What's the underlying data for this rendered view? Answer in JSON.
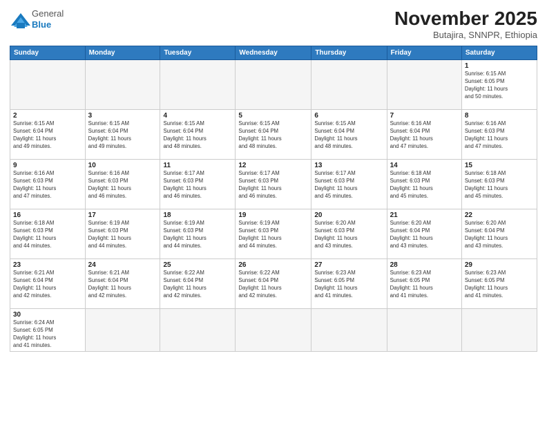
{
  "header": {
    "logo_general": "General",
    "logo_blue": "Blue",
    "month": "November 2025",
    "location": "Butajira, SNNPR, Ethiopia"
  },
  "weekdays": [
    "Sunday",
    "Monday",
    "Tuesday",
    "Wednesday",
    "Thursday",
    "Friday",
    "Saturday"
  ],
  "weeks": [
    [
      {
        "num": "",
        "info": ""
      },
      {
        "num": "",
        "info": ""
      },
      {
        "num": "",
        "info": ""
      },
      {
        "num": "",
        "info": ""
      },
      {
        "num": "",
        "info": ""
      },
      {
        "num": "",
        "info": ""
      },
      {
        "num": "1",
        "info": "Sunrise: 6:15 AM\nSunset: 6:05 PM\nDaylight: 11 hours\nand 50 minutes."
      }
    ],
    [
      {
        "num": "2",
        "info": "Sunrise: 6:15 AM\nSunset: 6:04 PM\nDaylight: 11 hours\nand 49 minutes."
      },
      {
        "num": "3",
        "info": "Sunrise: 6:15 AM\nSunset: 6:04 PM\nDaylight: 11 hours\nand 49 minutes."
      },
      {
        "num": "4",
        "info": "Sunrise: 6:15 AM\nSunset: 6:04 PM\nDaylight: 11 hours\nand 48 minutes."
      },
      {
        "num": "5",
        "info": "Sunrise: 6:15 AM\nSunset: 6:04 PM\nDaylight: 11 hours\nand 48 minutes."
      },
      {
        "num": "6",
        "info": "Sunrise: 6:15 AM\nSunset: 6:04 PM\nDaylight: 11 hours\nand 48 minutes."
      },
      {
        "num": "7",
        "info": "Sunrise: 6:16 AM\nSunset: 6:04 PM\nDaylight: 11 hours\nand 47 minutes."
      },
      {
        "num": "8",
        "info": "Sunrise: 6:16 AM\nSunset: 6:03 PM\nDaylight: 11 hours\nand 47 minutes."
      }
    ],
    [
      {
        "num": "9",
        "info": "Sunrise: 6:16 AM\nSunset: 6:03 PM\nDaylight: 11 hours\nand 47 minutes."
      },
      {
        "num": "10",
        "info": "Sunrise: 6:16 AM\nSunset: 6:03 PM\nDaylight: 11 hours\nand 46 minutes."
      },
      {
        "num": "11",
        "info": "Sunrise: 6:17 AM\nSunset: 6:03 PM\nDaylight: 11 hours\nand 46 minutes."
      },
      {
        "num": "12",
        "info": "Sunrise: 6:17 AM\nSunset: 6:03 PM\nDaylight: 11 hours\nand 46 minutes."
      },
      {
        "num": "13",
        "info": "Sunrise: 6:17 AM\nSunset: 6:03 PM\nDaylight: 11 hours\nand 45 minutes."
      },
      {
        "num": "14",
        "info": "Sunrise: 6:18 AM\nSunset: 6:03 PM\nDaylight: 11 hours\nand 45 minutes."
      },
      {
        "num": "15",
        "info": "Sunrise: 6:18 AM\nSunset: 6:03 PM\nDaylight: 11 hours\nand 45 minutes."
      }
    ],
    [
      {
        "num": "16",
        "info": "Sunrise: 6:18 AM\nSunset: 6:03 PM\nDaylight: 11 hours\nand 44 minutes."
      },
      {
        "num": "17",
        "info": "Sunrise: 6:19 AM\nSunset: 6:03 PM\nDaylight: 11 hours\nand 44 minutes."
      },
      {
        "num": "18",
        "info": "Sunrise: 6:19 AM\nSunset: 6:03 PM\nDaylight: 11 hours\nand 44 minutes."
      },
      {
        "num": "19",
        "info": "Sunrise: 6:19 AM\nSunset: 6:03 PM\nDaylight: 11 hours\nand 44 minutes."
      },
      {
        "num": "20",
        "info": "Sunrise: 6:20 AM\nSunset: 6:03 PM\nDaylight: 11 hours\nand 43 minutes."
      },
      {
        "num": "21",
        "info": "Sunrise: 6:20 AM\nSunset: 6:04 PM\nDaylight: 11 hours\nand 43 minutes."
      },
      {
        "num": "22",
        "info": "Sunrise: 6:20 AM\nSunset: 6:04 PM\nDaylight: 11 hours\nand 43 minutes."
      }
    ],
    [
      {
        "num": "23",
        "info": "Sunrise: 6:21 AM\nSunset: 6:04 PM\nDaylight: 11 hours\nand 42 minutes."
      },
      {
        "num": "24",
        "info": "Sunrise: 6:21 AM\nSunset: 6:04 PM\nDaylight: 11 hours\nand 42 minutes."
      },
      {
        "num": "25",
        "info": "Sunrise: 6:22 AM\nSunset: 6:04 PM\nDaylight: 11 hours\nand 42 minutes."
      },
      {
        "num": "26",
        "info": "Sunrise: 6:22 AM\nSunset: 6:04 PM\nDaylight: 11 hours\nand 42 minutes."
      },
      {
        "num": "27",
        "info": "Sunrise: 6:23 AM\nSunset: 6:05 PM\nDaylight: 11 hours\nand 41 minutes."
      },
      {
        "num": "28",
        "info": "Sunrise: 6:23 AM\nSunset: 6:05 PM\nDaylight: 11 hours\nand 41 minutes."
      },
      {
        "num": "29",
        "info": "Sunrise: 6:23 AM\nSunset: 6:05 PM\nDaylight: 11 hours\nand 41 minutes."
      }
    ],
    [
      {
        "num": "30",
        "info": "Sunrise: 6:24 AM\nSunset: 6:05 PM\nDaylight: 11 hours\nand 41 minutes."
      },
      {
        "num": "",
        "info": ""
      },
      {
        "num": "",
        "info": ""
      },
      {
        "num": "",
        "info": ""
      },
      {
        "num": "",
        "info": ""
      },
      {
        "num": "",
        "info": ""
      },
      {
        "num": "",
        "info": ""
      }
    ]
  ]
}
